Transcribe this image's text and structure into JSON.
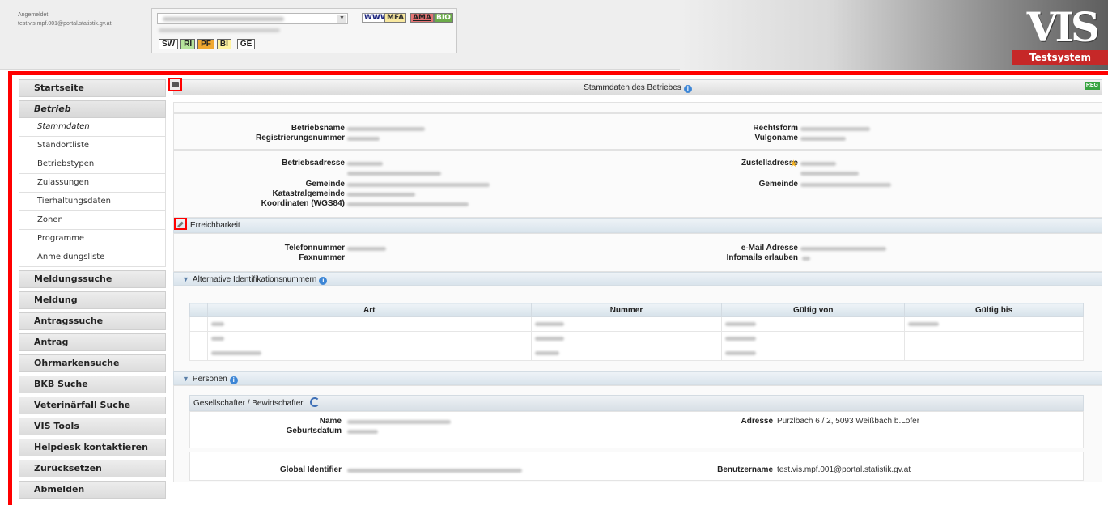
{
  "header": {
    "login_label": "Angemeldet:",
    "login_user": "test.vis.mpf.001@portal.statistik.gv.at",
    "tags": {
      "www": "WWW",
      "mfa": "MFA",
      "ama": "AMA",
      "bio": "BIO"
    },
    "codes": {
      "sw": "SW",
      "ri": "RI",
      "pf": "PF",
      "bi": "BI",
      "ge": "GE"
    },
    "logo_text": "VIS",
    "system_label": "Testsystem"
  },
  "sidebar": {
    "startseite": "Startseite",
    "betrieb": "Betrieb",
    "sub": [
      "Stammdaten",
      "Standortliste",
      "Betriebstypen",
      "Zulassungen",
      "Tierhaltungsdaten",
      "Zonen",
      "Programme",
      "Anmeldungsliste"
    ],
    "items": [
      "Meldungssuche",
      "Meldung",
      "Antragssuche",
      "Antrag",
      "Ohrmarkensuche",
      "BKB Suche",
      "Veterinärfall Suche",
      "VIS Tools",
      "Helpdesk kontaktieren",
      "Zurücksetzen",
      "Abmelden"
    ]
  },
  "main": {
    "title": "Stammdaten des Betriebes",
    "reg_badge": "REG",
    "labels": {
      "betriebsname": "Betriebsname",
      "registrierungsnummer": "Registrierungsnummer",
      "rechtsform": "Rechtsform",
      "vulgoname": "Vulgoname",
      "betriebsadresse": "Betriebsadresse",
      "gemeinde": "Gemeinde",
      "katastralgemeinde": "Katastralgemeinde",
      "koordinaten": "Koordinaten (WGS84)",
      "zustelladresse": "Zustelladresse",
      "gemeinde2": "Gemeinde"
    },
    "erreichbarkeit": {
      "title": "Erreichbarkeit",
      "telefon": "Telefonnummer",
      "fax": "Faxnummer",
      "email": "e-Mail Adresse",
      "infomails": "Infomails erlauben"
    },
    "alt_ids": {
      "title": "Alternative Identifikationsnummern",
      "columns": [
        "Art",
        "Nummer",
        "Gültig von",
        "Gültig bis"
      ]
    },
    "personen": {
      "title": "Personen",
      "subtitle": "Gesellschafter / Bewirtschafter",
      "name_label": "Name",
      "geburtsdatum_label": "Geburtsdatum",
      "adresse_label": "Adresse",
      "adresse_value": "Pürzlbach 6 / 2, 5093 Weißbach b.Lofer",
      "global_id_label": "Global Identifier",
      "benutzername_label": "Benutzername",
      "benutzername_value": "test.vis.mpf.001@portal.statistik.gv.at"
    }
  },
  "colors": {
    "frame": "#ff0000",
    "reg": "#37a33f",
    "info": "#3d86d6",
    "testsystem": "#c62828"
  }
}
